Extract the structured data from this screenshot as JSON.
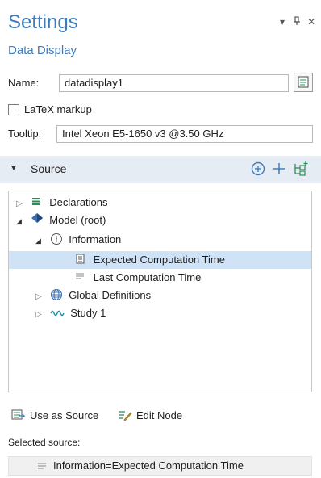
{
  "header": {
    "title": "Settings",
    "subtitle": "Data Display"
  },
  "window_controls": {
    "dropdown_icon": "chevron-down-icon",
    "pin_icon": "pin-icon",
    "close_icon": "close-icon"
  },
  "form": {
    "name_label": "Name:",
    "name_value": "datadisplay1",
    "latex_label": "LaTeX markup",
    "latex_checked": false,
    "tooltip_label": "Tooltip:",
    "tooltip_value": "Intel Xeon E5-1650 v3 @3.50 GHz"
  },
  "source_section": {
    "title": "Source",
    "tools": [
      "add-circle-icon",
      "plus-icon",
      "tree-add-icon"
    ]
  },
  "tree": {
    "declarations": "Declarations",
    "model": "Model (root)",
    "information": "Information",
    "expected": "Expected Computation Time",
    "last": "Last Computation Time",
    "global": "Global Definitions",
    "study": "Study 1"
  },
  "actions": {
    "use_as_source": "Use as Source",
    "edit_node": "Edit Node"
  },
  "selected_source": {
    "label": "Selected source:",
    "value": "Information=Expected Computation Time"
  },
  "colors": {
    "accent": "#3d7cbf",
    "section_bg": "#e6ecf4",
    "selection_bg": "#cfe2f6",
    "icon_green": "#2e8b57"
  }
}
